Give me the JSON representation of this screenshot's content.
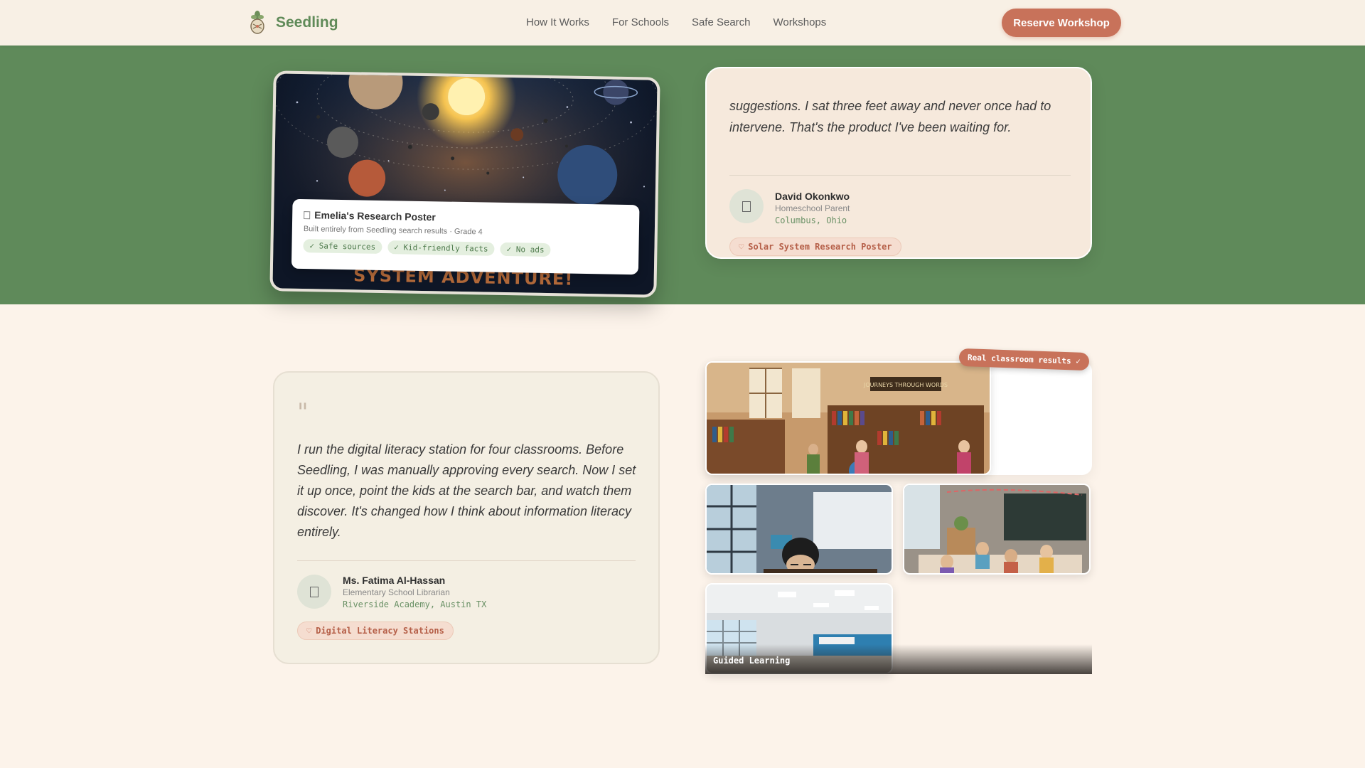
{
  "nav": {
    "brand": "Seedling",
    "links": [
      "How It Works",
      "For Schools",
      "Safe Search",
      "Workshops"
    ],
    "cta": "Reserve Workshop"
  },
  "poster": {
    "title_fragment": "SYSTEM ADVENTURE!",
    "card_title": "Emelia's Research Poster",
    "card_subtitle": "Built entirely from Seedling search results · Grade 4",
    "tags": [
      "✓ Safe sources",
      "✓ Kid-friendly facts",
      "✓ No ads"
    ]
  },
  "testimonial_1": {
    "quote": "suggestions. I sat three feet away and never once had to intervene. That's the product I've been waiting for.",
    "name": "David Okonkwo",
    "role": "Homeschool Parent",
    "location": "Columbus, Ohio",
    "project": "Solar System Research Poster"
  },
  "testimonial_2": {
    "quote_mark": "\"",
    "quote": "I run the digital literacy station for four classrooms. Before Seedling, I was manually approving every search. Now I set it up once, point the kids at the search bar, and watch them discover. It's changed how I think about information literacy entirely.",
    "name": "Ms. Fatima Al-Hassan",
    "role": "Elementary School Librarian",
    "location": "Riverside Academy, Austin TX",
    "project": "Digital Literacy Stations"
  },
  "gallery": {
    "badge": "Real classroom results ✓",
    "library_banner": "JOURNEYS THROUGH WORDS",
    "caption": "Guided Learning"
  },
  "colors": {
    "brand_green": "#5f8a58",
    "accent": "#c8725a",
    "band_green": "#5f8a5a",
    "cream": "#fcf3ea"
  }
}
